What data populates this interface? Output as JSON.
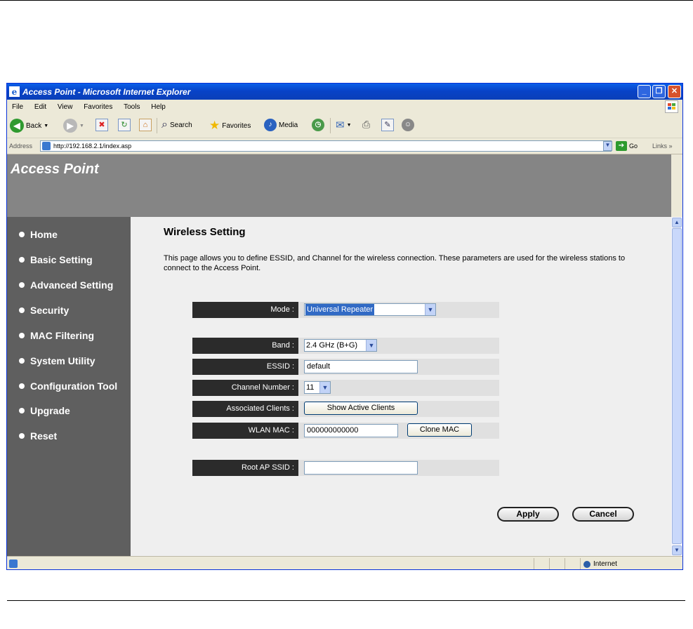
{
  "window": {
    "title": "Access Point - Microsoft Internet Explorer",
    "buttons": [
      "_",
      "❐",
      "✕"
    ]
  },
  "menu": [
    "File",
    "Edit",
    "View",
    "Favorites",
    "Tools",
    "Help"
  ],
  "toolbar": {
    "back": "Back",
    "search": "Search",
    "favorites": "Favorites",
    "media": "Media"
  },
  "address": {
    "label": "Address",
    "url": "http://192.168.2.1/index.asp",
    "go": "Go",
    "links": "Links"
  },
  "page": {
    "brand": "Access Point",
    "nav": [
      "Home",
      "Basic Setting",
      "Advanced Setting",
      "Security",
      "MAC Filtering",
      "System Utility",
      "Configuration Tool",
      "Upgrade",
      "Reset"
    ],
    "heading": "Wireless Setting",
    "description": "This page allows you to define ESSID, and Channel for the wireless connection. These parameters are used for the wireless stations to connect to the Access Point.",
    "form": {
      "mode_label": "Mode :",
      "mode_value": "Universal Repeater",
      "band_label": "Band :",
      "band_value": "2.4 GHz (B+G)",
      "essid_label": "ESSID :",
      "essid_value": "default",
      "channel_label": "Channel Number :",
      "channel_value": "11",
      "clients_label": "Associated Clients :",
      "clients_button": "Show Active Clients",
      "wlanmac_label": "WLAN MAC :",
      "wlanmac_value": "000000000000",
      "clone_button": "Clone MAC",
      "rootap_label": "Root AP SSID :",
      "rootap_value": ""
    },
    "apply": "Apply",
    "cancel": "Cancel"
  },
  "status": {
    "zone": "Internet"
  }
}
